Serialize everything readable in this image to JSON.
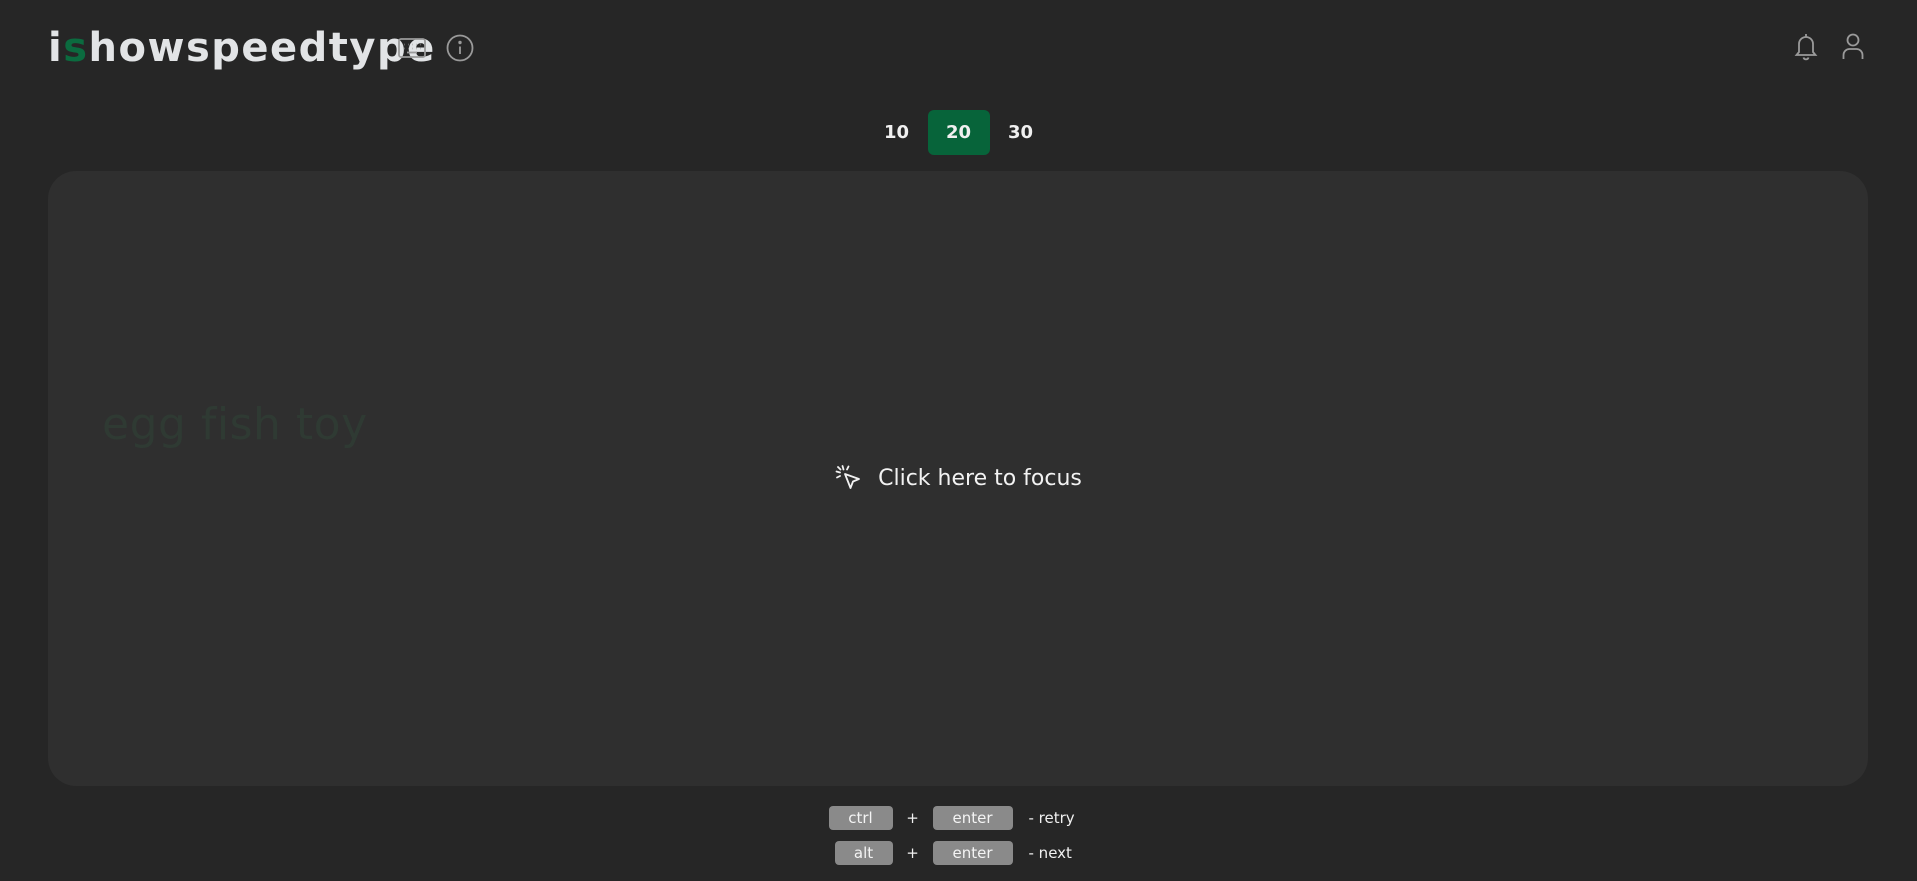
{
  "header": {
    "logo_prefix": "i",
    "logo_accent": "s",
    "logo_rest": "howspeedtype",
    "icons": [
      "keyboard-icon",
      "info-icon",
      "bell-icon",
      "user-icon"
    ]
  },
  "word_counts": {
    "options": [
      "10",
      "20",
      "30"
    ],
    "selected": "20"
  },
  "typing_area": {
    "ghost_words": "egg fish toy",
    "focus_prompt": "Click here to focus"
  },
  "shortcuts": [
    {
      "key1": "ctrl",
      "plus": "+",
      "key2": "enter",
      "action": "- retry"
    },
    {
      "key1": "alt",
      "plus": "+",
      "key2": "enter",
      "action": "- next"
    }
  ],
  "colors": {
    "background": "#262626",
    "panel": "#2f2f2f",
    "accent": "#07643a",
    "key": "#8a8a8a"
  }
}
